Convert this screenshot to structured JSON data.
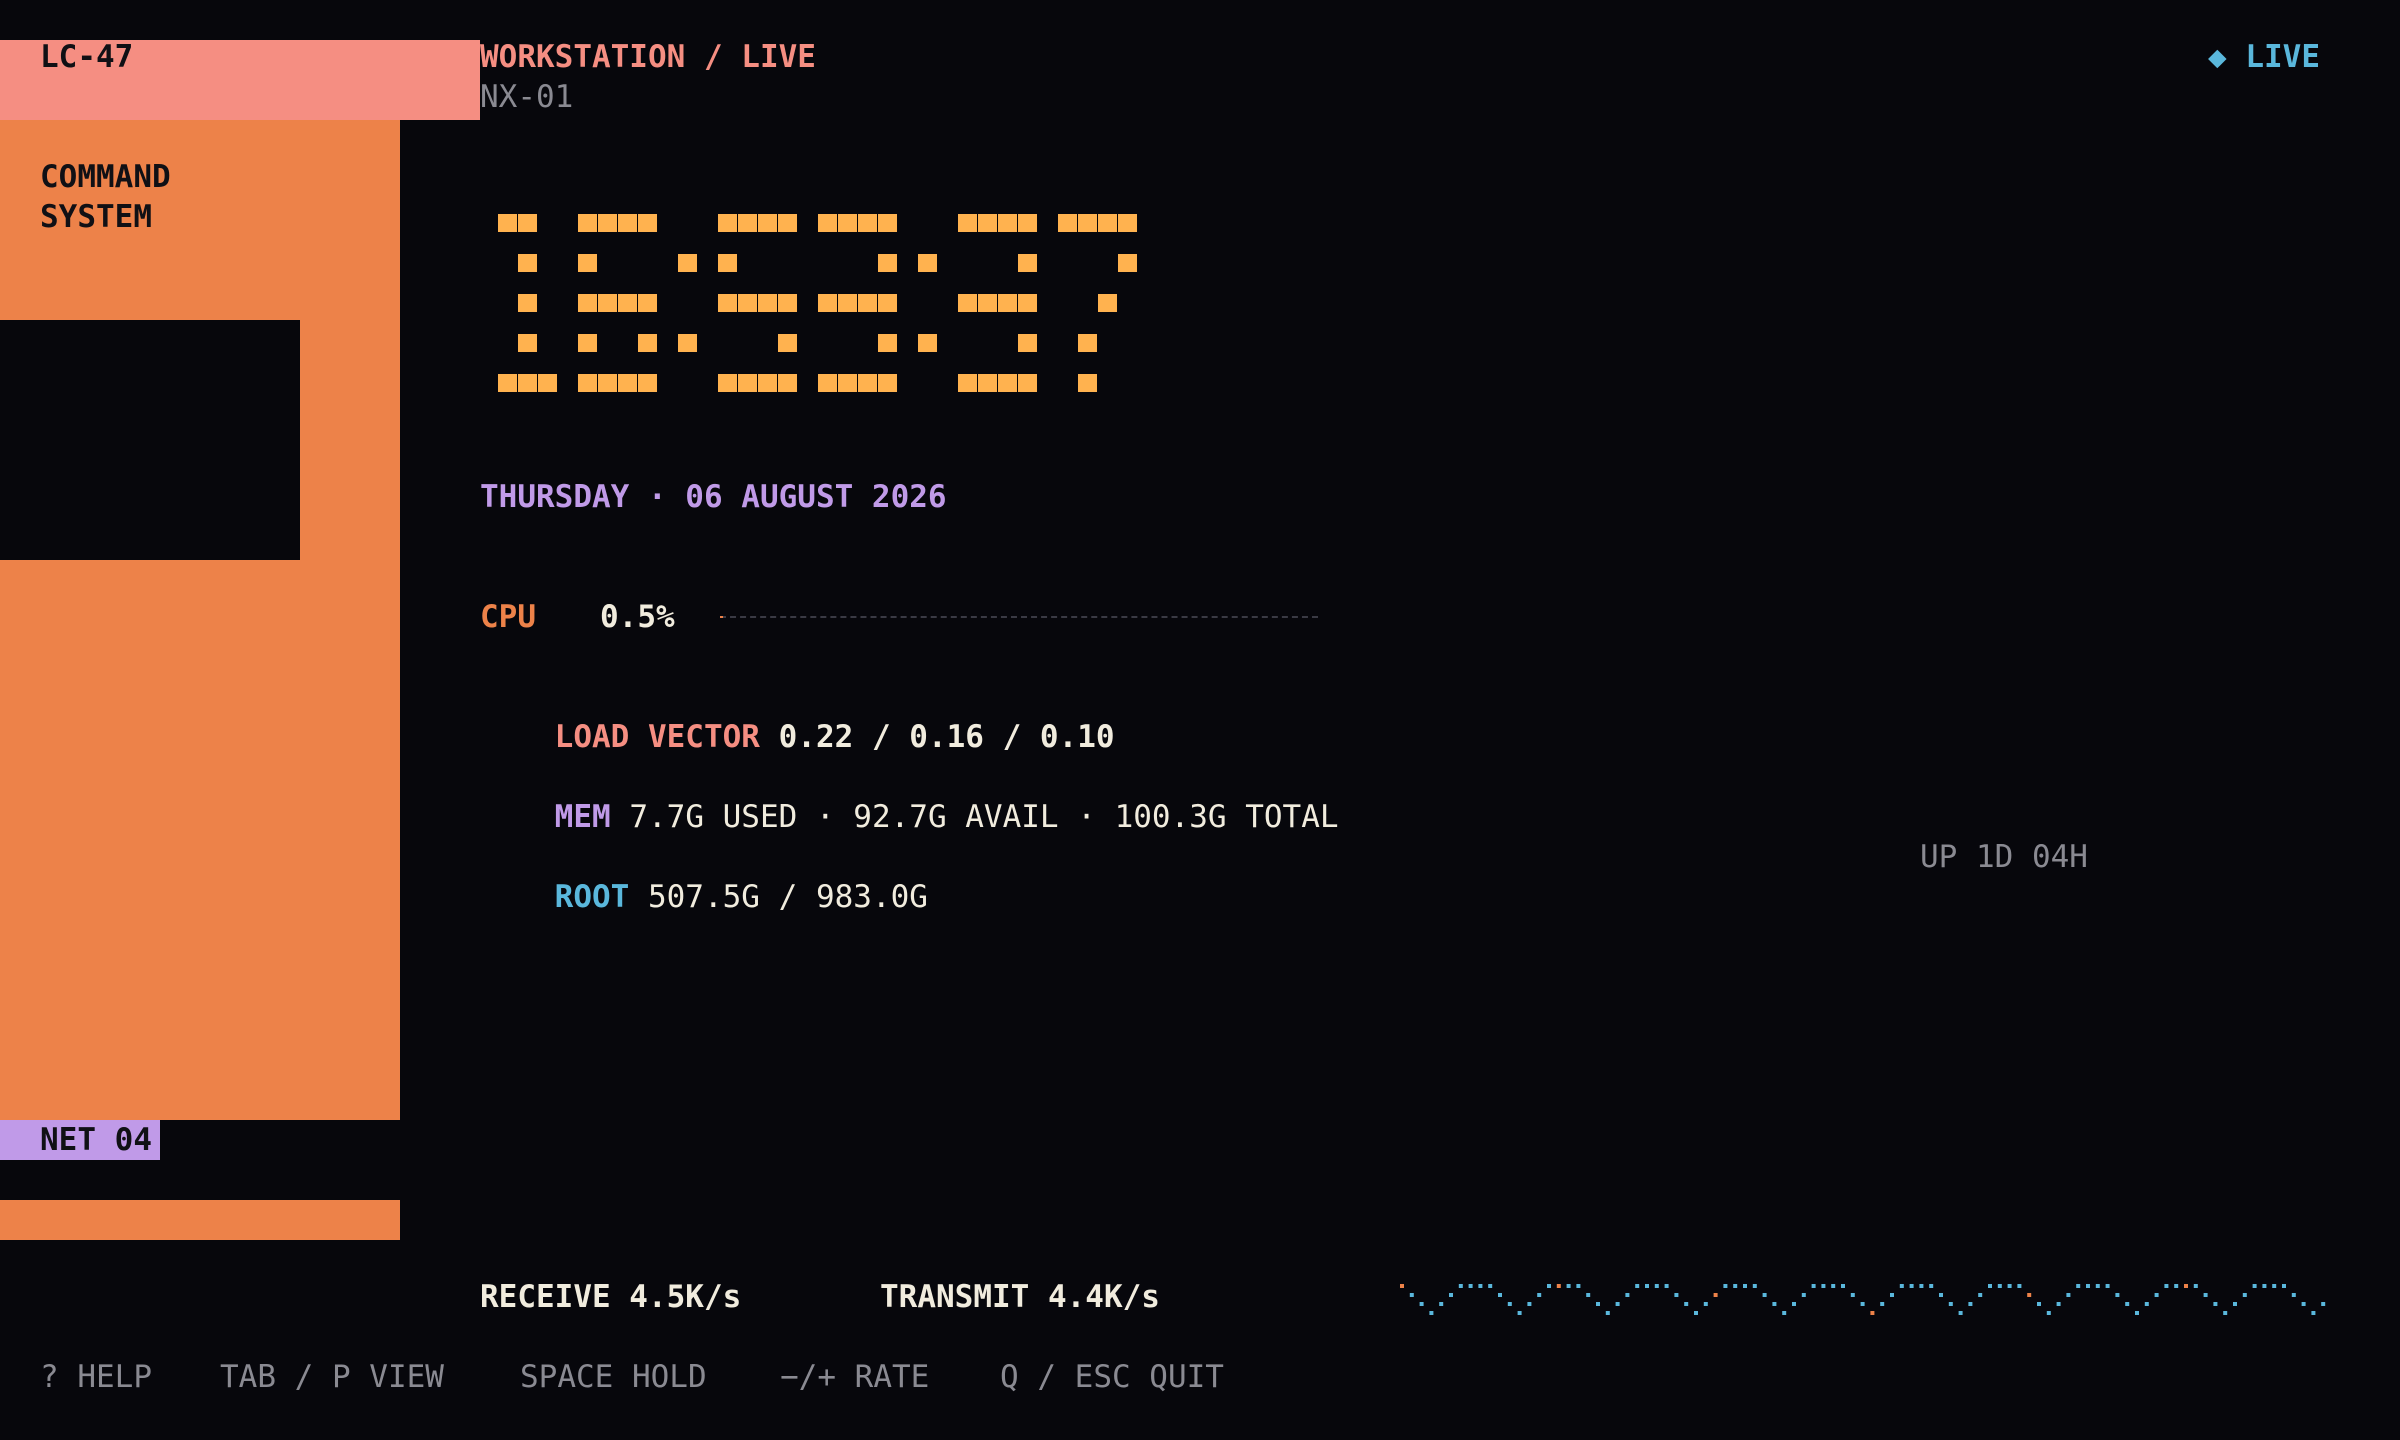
{
  "sidebar": {
    "top_label": "LC-47",
    "section_label_1": "COMMAND",
    "section_label_2": "SYSTEM",
    "net_label": "NET 04"
  },
  "header": {
    "title": "WORKSTATION / LIVE",
    "subtitle": "NX-01",
    "live_indicator": "◆ LIVE"
  },
  "clock": {
    "time": "16:53:37",
    "date": "THURSDAY · 06 AUGUST 2026"
  },
  "stats": {
    "cpu_label": "CPU",
    "cpu_value": "0.5%",
    "cpu_fraction": 0.005,
    "load_label": "LOAD VECTOR",
    "load_value": "0.22 / 0.16 / 0.10",
    "mem_label": "MEM",
    "mem_value": "7.7G USED · 92.7G AVAIL · 100.3G TOTAL",
    "root_label": "ROOT",
    "root_value": "507.5G / 983.0G",
    "uptime": "UP 1D 04H"
  },
  "network": {
    "receive": "RECEIVE 4.5K/s",
    "transmit": "TRANSMIT 4.4K/s"
  },
  "footer": {
    "help": "? HELP",
    "view": "TAB / P VIEW",
    "hold": "SPACE HOLD",
    "rate": "−/+ RATE",
    "quit": "Q / ESC QUIT"
  },
  "colors": {
    "background": "#07070c",
    "salmon": "#f58e82",
    "orange": "#ed8249",
    "violet": "#c09ae8",
    "blue": "#5ab7dc",
    "amber": "#ffb24f",
    "cream": "#f1ecde",
    "grey": "#8a8a92"
  }
}
